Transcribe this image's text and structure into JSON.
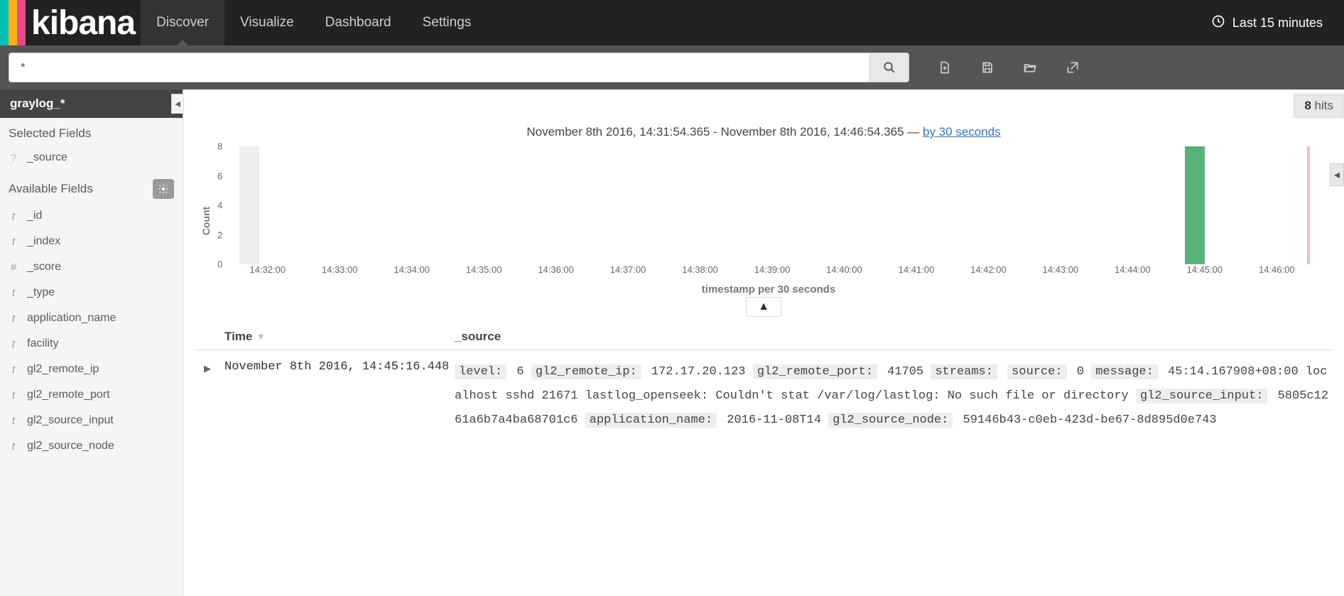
{
  "app": {
    "name": "kibana"
  },
  "nav": {
    "tabs": [
      "Discover",
      "Visualize",
      "Dashboard",
      "Settings"
    ],
    "active": 0
  },
  "time_picker": {
    "label": "Last 15 minutes"
  },
  "search": {
    "value": "*"
  },
  "sidebar": {
    "index_pattern": "graylog_*",
    "selected_title": "Selected Fields",
    "selected": [
      {
        "type": "?",
        "name": "_source"
      }
    ],
    "available_title": "Available Fields",
    "available": [
      {
        "type": "t",
        "name": "_id"
      },
      {
        "type": "t",
        "name": "_index"
      },
      {
        "type": "#",
        "name": "_score"
      },
      {
        "type": "t",
        "name": "_type"
      },
      {
        "type": "t",
        "name": "application_name"
      },
      {
        "type": "t",
        "name": "facility"
      },
      {
        "type": "t",
        "name": "gl2_remote_ip"
      },
      {
        "type": "t",
        "name": "gl2_remote_port"
      },
      {
        "type": "t",
        "name": "gl2_source_input"
      },
      {
        "type": "t",
        "name": "gl2_source_node"
      }
    ]
  },
  "hits": {
    "count": "8",
    "label": "hits"
  },
  "range": {
    "from": "November 8th 2016, 14:31:54.365",
    "to": "November 8th 2016, 14:46:54.365",
    "interval_prefix": "by ",
    "interval": "30 seconds"
  },
  "chart_data": {
    "type": "bar",
    "ylabel": "Count",
    "xlabel": "timestamp per 30 seconds",
    "ylim": [
      0,
      8
    ],
    "yticks": [
      0,
      2,
      4,
      6,
      8
    ],
    "xticks": [
      "14:32:00",
      "14:33:00",
      "14:34:00",
      "14:35:00",
      "14:36:00",
      "14:37:00",
      "14:38:00",
      "14:39:00",
      "14:40:00",
      "14:41:00",
      "14:42:00",
      "14:43:00",
      "14:44:00",
      "14:45:00",
      "14:46:00"
    ],
    "bars": [
      {
        "x_frac": 0.007,
        "value": 8,
        "ghost": true
      },
      {
        "x_frac": 0.882,
        "value": 8,
        "ghost": false
      },
      {
        "x_frac": 0.995,
        "value": 8,
        "red": true
      }
    ]
  },
  "table": {
    "headers": {
      "time": "Time",
      "source": "_source"
    },
    "rows": [
      {
        "time": "November 8th 2016, 14:45:16.448",
        "kv": [
          {
            "k": "level:",
            "v": "6"
          },
          {
            "k": "gl2_remote_ip:",
            "v": "172.17.20.123"
          },
          {
            "k": "gl2_remote_port:",
            "v": "41705"
          },
          {
            "k": "streams:",
            "v": ""
          },
          {
            "k": "source:",
            "v": "0"
          },
          {
            "k": "message:",
            "v": "45:14.167908+08:00 localhost sshd 21671 lastlog_openseek: Couldn't stat /var/log/lastlog: No such file or directory"
          },
          {
            "k": "gl2_source_input:",
            "v": "5805c1261a6b7a4ba68701c6"
          },
          {
            "k": "application_name:",
            "v": "2016-11-08T14"
          },
          {
            "k": "gl2_source_node:",
            "v": "59146b43-c0eb-423d-be67-8d895d0e743"
          }
        ]
      }
    ]
  }
}
